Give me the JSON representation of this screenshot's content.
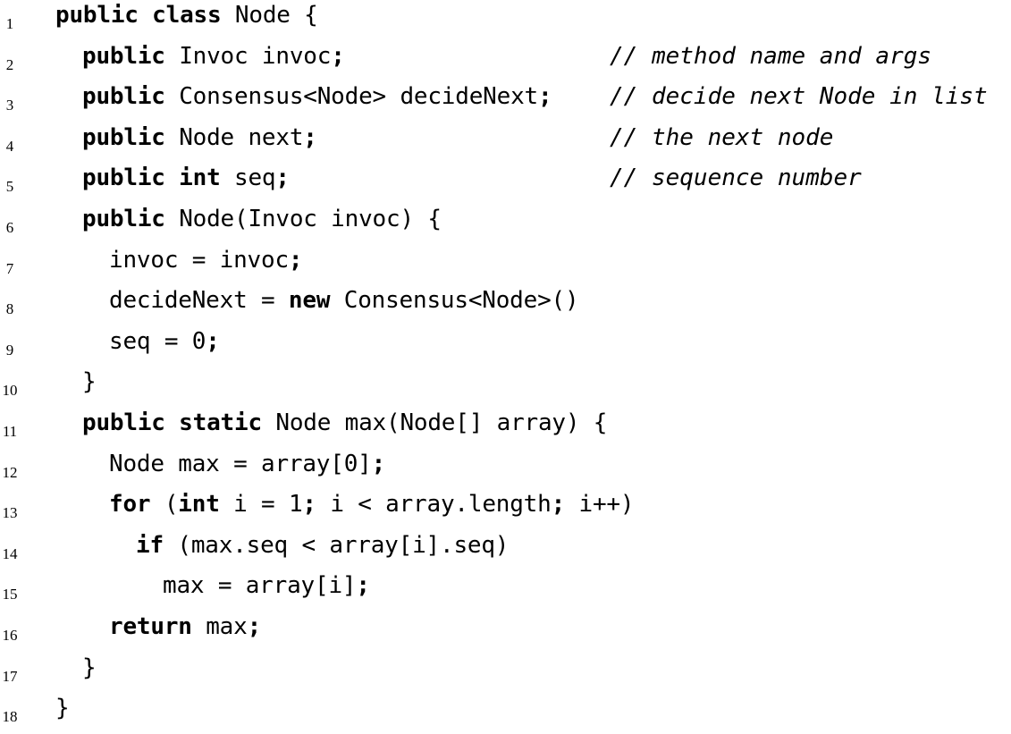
{
  "lines": [
    {
      "n": "1",
      "indent": 0,
      "segs": [
        {
          "t": "public class",
          "k": "kw"
        },
        {
          "t": " Node {",
          "k": ""
        }
      ]
    },
    {
      "n": "2",
      "indent": 1,
      "segs": [
        {
          "t": "public",
          "k": "kw"
        },
        {
          "t": " Invoc invoc",
          "k": ""
        },
        {
          "t": ";",
          "k": "kw"
        }
      ],
      "comment": "// method name and args"
    },
    {
      "n": "3",
      "indent": 1,
      "segs": [
        {
          "t": "public",
          "k": "kw"
        },
        {
          "t": " Consensus<Node> decideNext",
          "k": ""
        },
        {
          "t": ";",
          "k": "kw"
        }
      ],
      "comment": "// decide next Node in list"
    },
    {
      "n": "4",
      "indent": 1,
      "segs": [
        {
          "t": "public",
          "k": "kw"
        },
        {
          "t": " Node next",
          "k": ""
        },
        {
          "t": ";",
          "k": "kw"
        }
      ],
      "comment": "// the next node"
    },
    {
      "n": "5",
      "indent": 1,
      "segs": [
        {
          "t": "public int",
          "k": "kw"
        },
        {
          "t": " seq",
          "k": ""
        },
        {
          "t": ";",
          "k": "kw"
        }
      ],
      "comment": "// sequence number"
    },
    {
      "n": "6",
      "indent": 1,
      "segs": [
        {
          "t": "public",
          "k": "kw"
        },
        {
          "t": " Node(Invoc invoc) {",
          "k": ""
        }
      ]
    },
    {
      "n": "7",
      "indent": 2,
      "segs": [
        {
          "t": "invoc = invoc",
          "k": ""
        },
        {
          "t": ";",
          "k": "kw"
        }
      ]
    },
    {
      "n": "8",
      "indent": 2,
      "segs": [
        {
          "t": "decideNext = ",
          "k": ""
        },
        {
          "t": "new",
          "k": "kw"
        },
        {
          "t": " Consensus<Node>()",
          "k": ""
        }
      ]
    },
    {
      "n": "9",
      "indent": 2,
      "segs": [
        {
          "t": "seq = 0",
          "k": ""
        },
        {
          "t": ";",
          "k": "kw"
        }
      ]
    },
    {
      "n": "10",
      "indent": 1,
      "segs": [
        {
          "t": "}",
          "k": ""
        }
      ]
    },
    {
      "n": "11",
      "indent": 1,
      "segs": [
        {
          "t": "public static",
          "k": "kw"
        },
        {
          "t": " Node max(Node[] array) {",
          "k": ""
        }
      ]
    },
    {
      "n": "12",
      "indent": 2,
      "segs": [
        {
          "t": "Node max = array[0]",
          "k": ""
        },
        {
          "t": ";",
          "k": "kw"
        }
      ]
    },
    {
      "n": "13",
      "indent": 2,
      "segs": [
        {
          "t": "for",
          "k": "kw"
        },
        {
          "t": " (",
          "k": ""
        },
        {
          "t": "int",
          "k": "kw"
        },
        {
          "t": " i = 1",
          "k": ""
        },
        {
          "t": ";",
          "k": "kw"
        },
        {
          "t": " i < array.length",
          "k": ""
        },
        {
          "t": ";",
          "k": "kw"
        },
        {
          "t": " i++)",
          "k": ""
        }
      ]
    },
    {
      "n": "14",
      "indent": 3,
      "segs": [
        {
          "t": "if",
          "k": "kw"
        },
        {
          "t": " (max.seq < array[i].seq)",
          "k": ""
        }
      ]
    },
    {
      "n": "15",
      "indent": 4,
      "segs": [
        {
          "t": "max = array[i]",
          "k": ""
        },
        {
          "t": ";",
          "k": "kw"
        }
      ]
    },
    {
      "n": "16",
      "indent": 2,
      "segs": [
        {
          "t": "return",
          "k": "kw"
        },
        {
          "t": " max",
          "k": ""
        },
        {
          "t": ";",
          "k": "kw"
        }
      ]
    },
    {
      "n": "17",
      "indent": 1,
      "segs": [
        {
          "t": "}",
          "k": ""
        }
      ]
    },
    {
      "n": "18",
      "indent": 0,
      "segs": [
        {
          "t": "}",
          "k": ""
        }
      ]
    }
  ]
}
